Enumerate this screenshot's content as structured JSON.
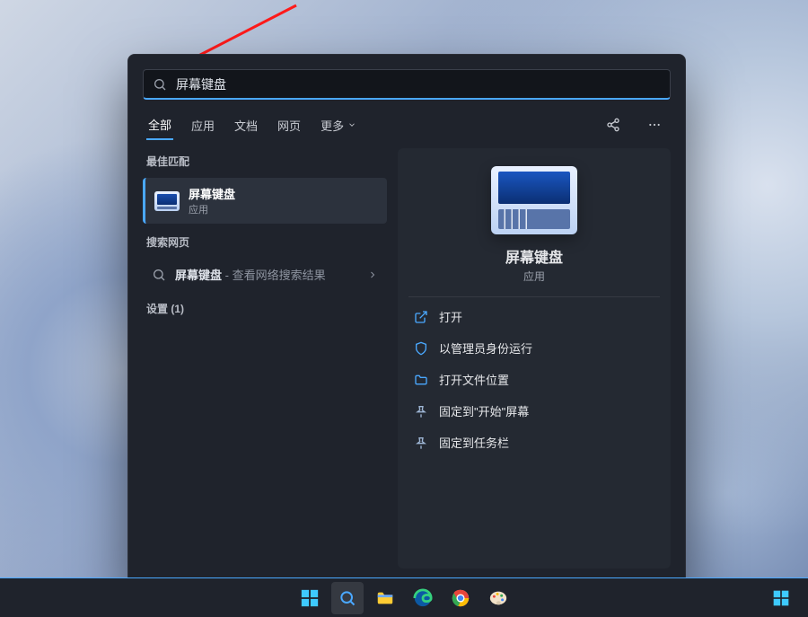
{
  "search": {
    "value": "屏幕键盘",
    "placeholder": ""
  },
  "tabs": {
    "items": [
      "全部",
      "应用",
      "文档",
      "网页",
      "更多"
    ],
    "active_index": 0
  },
  "left": {
    "section_best": "最佳匹配",
    "best_match": {
      "title": "屏幕键盘",
      "subtitle": "应用"
    },
    "section_web": "搜索网页",
    "web_item": {
      "query": "屏幕键盘",
      "suffix": " - 查看网络搜索结果"
    },
    "settings_section": "设置 (1)"
  },
  "detail": {
    "title": "屏幕键盘",
    "subtitle": "应用",
    "actions": [
      {
        "icon": "open-external",
        "label": "打开"
      },
      {
        "icon": "shield",
        "label": "以管理员身份运行"
      },
      {
        "icon": "folder",
        "label": "打开文件位置"
      },
      {
        "icon": "pin",
        "label": "固定到\"开始\"屏幕"
      },
      {
        "icon": "pin",
        "label": "固定到任务栏"
      }
    ]
  },
  "taskbar": {
    "items": [
      "start",
      "search",
      "explorer",
      "edge",
      "chrome",
      "paint"
    ]
  }
}
